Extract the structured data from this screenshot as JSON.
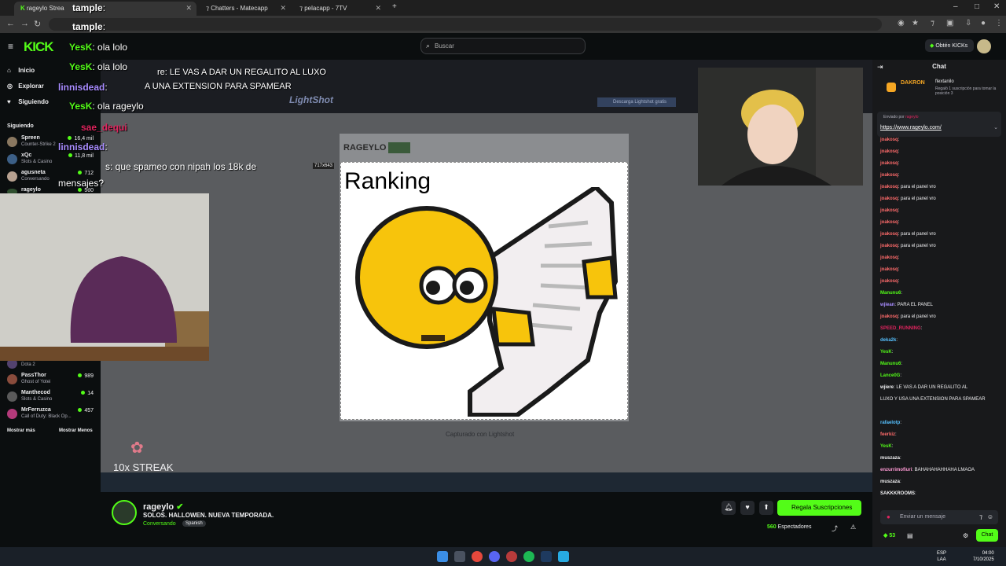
{
  "browser": {
    "tabs": [
      {
        "label": "rageylo Strea"
      },
      {
        "label": "Chatters - Matecapp"
      },
      {
        "label": "pelacapp - 7TV"
      }
    ],
    "window_controls": [
      "–",
      "□",
      "✕"
    ]
  },
  "header": {
    "logo": "KICK",
    "search_placeholder": "Buscar",
    "get_kicks_label": "Obtén KICKs"
  },
  "sidebar": {
    "nav": [
      {
        "label": "Inicio",
        "icon": "home-icon"
      },
      {
        "label": "Explorar",
        "icon": "compass-icon"
      },
      {
        "label": "Siguiendo",
        "icon": "heart-icon"
      }
    ],
    "following_title": "Siguiendo",
    "following": [
      {
        "name": "Spreen",
        "game": "Counter-Strike 2",
        "viewers": "16,4 mil",
        "color": "#8a7860"
      },
      {
        "name": "xQc",
        "game": "Slots & Casino",
        "viewers": "11,8 mil",
        "color": "#3c5f86"
      },
      {
        "name": "agusneta",
        "game": "Conversando",
        "viewers": "712",
        "color": "#b7a190"
      },
      {
        "name": "rageylo",
        "game": "",
        "viewers": "560",
        "color": "#2f4f2f"
      }
    ],
    "following_lower": [
      {
        "name": "",
        "game": "Dota 2",
        "viewers": "",
        "color": "#53426e"
      },
      {
        "name": "PassThor",
        "game": "Ghost of Yotei",
        "viewers": "989",
        "color": "#8a4c3c"
      },
      {
        "name": "Manthecod",
        "game": "Slots & Casino",
        "viewers": "14",
        "color": "#5a5a5a"
      },
      {
        "name": "MrFerruzca",
        "game": "Call of Duty: Black Op...",
        "viewers": "457",
        "color": "#b33a7a"
      }
    ],
    "show_more": "Mostrar más",
    "show_less": "Mostrar Menos"
  },
  "stream": {
    "lightshot_title": "LightShot",
    "lightshot_download": "Descarga Lightshot gratis",
    "image_tag": "RAGEYLO",
    "image_size": "717x643",
    "ranking_text": "Ranking",
    "caption": "Capturado con Lightshot",
    "streak": "10x STREAK",
    "overlay_chat": [
      {
        "user": "tample",
        "text": ":",
        "color": "#e0e0e0"
      },
      {
        "user": "tample",
        "text": ":",
        "color": "#e0e0e0"
      },
      {
        "user": "YesK",
        "text": ": ola lolo",
        "color": "#53fc18"
      },
      {
        "user": "YesK",
        "text": ": ola lolo",
        "color": "#53fc18"
      },
      {
        "user": "",
        "text": "re: LE VAS A DAR UN REGALITO AL LUXO",
        "color": "#ffffff"
      },
      {
        "user": "linnisdead",
        "text": ":",
        "color": "#a88cff"
      },
      {
        "user": "",
        "text": "A UNA EXTENSION PARA SPAMEAR",
        "color": "#ffffff"
      },
      {
        "user": "YesK",
        "text": ": ola rageylo",
        "color": "#53fc18"
      },
      {
        "user": "sae_dequi",
        "text": "",
        "color": "#e0245e"
      },
      {
        "user": "linnisdead",
        "text": ":",
        "color": "#a88cff"
      },
      {
        "user": "",
        "text": "s: que spameo con nipah los 18k de",
        "color": "#ffffff"
      },
      {
        "user": "",
        "text": "mensajes?",
        "color": "#ffffff"
      }
    ]
  },
  "channel": {
    "name": "rageylo",
    "title": "SOLOS. HALLOWEN. NUEVA TEMPORADA.",
    "category": "Conversando",
    "language": "Spanish",
    "subscribe_label": "Regala Suscripciones",
    "viewers": "560",
    "viewers_label": "Espectadores"
  },
  "chat": {
    "title": "Chat",
    "gift_user": "DAKRON",
    "gift_to": "flextanilo",
    "gift_text": "Regaló 1 suscripción para tomar la posición 3",
    "pinned_by": "Enviado por",
    "pinned_link": "https://www.rageylo.com/",
    "messages": [
      {
        "user": "joakosq",
        "text": ":",
        "color": "#ff6b6b"
      },
      {
        "user": "joakosq",
        "text": ":",
        "color": "#ff6b6b"
      },
      {
        "user": "joakosq",
        "text": ":",
        "color": "#ff6b6b"
      },
      {
        "user": "joakosq",
        "text": ":",
        "color": "#ff6b6b"
      },
      {
        "user": "joakosq",
        "text": ": para el panel vro",
        "color": "#ff6b6b"
      },
      {
        "user": "joakosq",
        "text": ": para el panel vro",
        "color": "#ff6b6b"
      },
      {
        "user": "joakosq",
        "text": ":",
        "color": "#ff6b6b"
      },
      {
        "user": "joakosq",
        "text": ":",
        "color": "#ff6b6b"
      },
      {
        "user": "joakosq",
        "text": ": para el panel vro",
        "color": "#ff6b6b"
      },
      {
        "user": "joakosq",
        "text": ": para el panel vro",
        "color": "#ff6b6b"
      },
      {
        "user": "joakosq",
        "text": ":",
        "color": "#ff6b6b"
      },
      {
        "user": "joakosq",
        "text": ":",
        "color": "#ff6b6b"
      },
      {
        "user": "joakosq",
        "text": ":",
        "color": "#ff6b6b"
      },
      {
        "user": "Manunu6",
        "text": ":",
        "color": "#53fc18"
      },
      {
        "user": "wjiean",
        "text": ": PARA EL PANEL",
        "color": "#a88cff"
      },
      {
        "user": "joakosq",
        "text": ": para el panel vro",
        "color": "#ff6b6b"
      },
      {
        "user": "SPEED_RUNNING",
        "text": ":",
        "color": "#e0245e"
      },
      {
        "user": "deka2k",
        "text": ":",
        "color": "#56c1ff"
      },
      {
        "user": "YesK",
        "text": ":",
        "color": "#53fc18"
      },
      {
        "user": "Manunu6",
        "text": ":",
        "color": "#53fc18"
      },
      {
        "user": "Lance0G",
        "text": ":",
        "color": "#53fc18"
      },
      {
        "user": "wjiere",
        "text": ": LE VAS A DAR UN REGALITO AL",
        "color": "#efeff1"
      },
      {
        "user": "",
        "text": "LUXO Y USA UNA EXTENSION PARA SPAMEAR",
        "color": "#efeff1"
      },
      {
        "user": "",
        "text": "",
        "color": "#efeff1"
      },
      {
        "user": "rafaelotp",
        "text": ":",
        "color": "#56c1ff"
      },
      {
        "user": "feerkiz",
        "text": ":",
        "color": "#ff6b6b"
      },
      {
        "user": "YesK",
        "text": ":",
        "color": "#53fc18"
      },
      {
        "user": "muszaza",
        "text": ":",
        "color": "#efeff1"
      },
      {
        "user": "enzurrimofiuri",
        "text": ": BAHAHAHAHHAHA LMAOA",
        "color": "#ff9ad5"
      },
      {
        "user": "muszaza",
        "text": ":",
        "color": "#efeff1"
      },
      {
        "user": "SAKKKROOMS",
        "text": ":",
        "color": "#efeff1"
      }
    ],
    "input_placeholder": "Enviar un mensaje",
    "kicks": "53",
    "send_label": "Chat"
  },
  "taskbar": {
    "lang": "ESP\nLAA",
    "time": "04:00",
    "date": "7/10/2025"
  }
}
